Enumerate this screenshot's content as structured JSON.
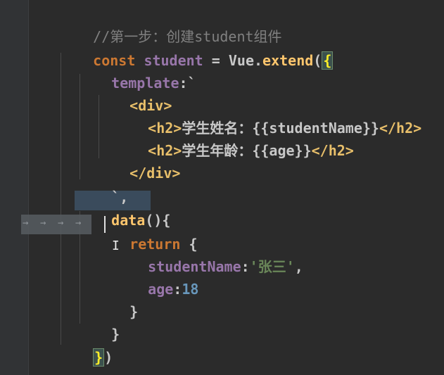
{
  "editor": {
    "lines": {
      "l1": {
        "comment": "//第一步：创建student组件"
      },
      "l2": {
        "kw": "const",
        "name": "student",
        "eq": " = ",
        "obj": "Vue",
        "dot": ".",
        "method": "extend",
        "paren": "(",
        "brace": "{"
      },
      "l3": {
        "prop": "template",
        "rest": ":`"
      },
      "l4": {
        "tag": "<div>"
      },
      "l5": {
        "open": "<h2>",
        "text": "学生姓名：{{studentName}}",
        "close": "</h2>"
      },
      "l6": {
        "open": "<h2>",
        "text": "学生年龄：{{age}}",
        "close": "</h2>"
      },
      "l7": {
        "tag": "</div>"
      },
      "l8": {
        "text": "`,"
      },
      "l9": {
        "func": "data",
        "rest": "(){"
      },
      "l10": {
        "kw": "return",
        "rest": " {"
      },
      "l11": {
        "prop": "studentName",
        "colon": ":",
        "str": "'张三'",
        "comma": ","
      },
      "l12": {
        "prop": "age",
        "colon": ":",
        "num": "18"
      },
      "l13": {
        "text": "}"
      },
      "l14": {
        "text": "}"
      },
      "l15": {
        "brace": "}",
        "paren": ")"
      }
    },
    "tab_glyph": "→",
    "ibeam_glyph": "I"
  }
}
